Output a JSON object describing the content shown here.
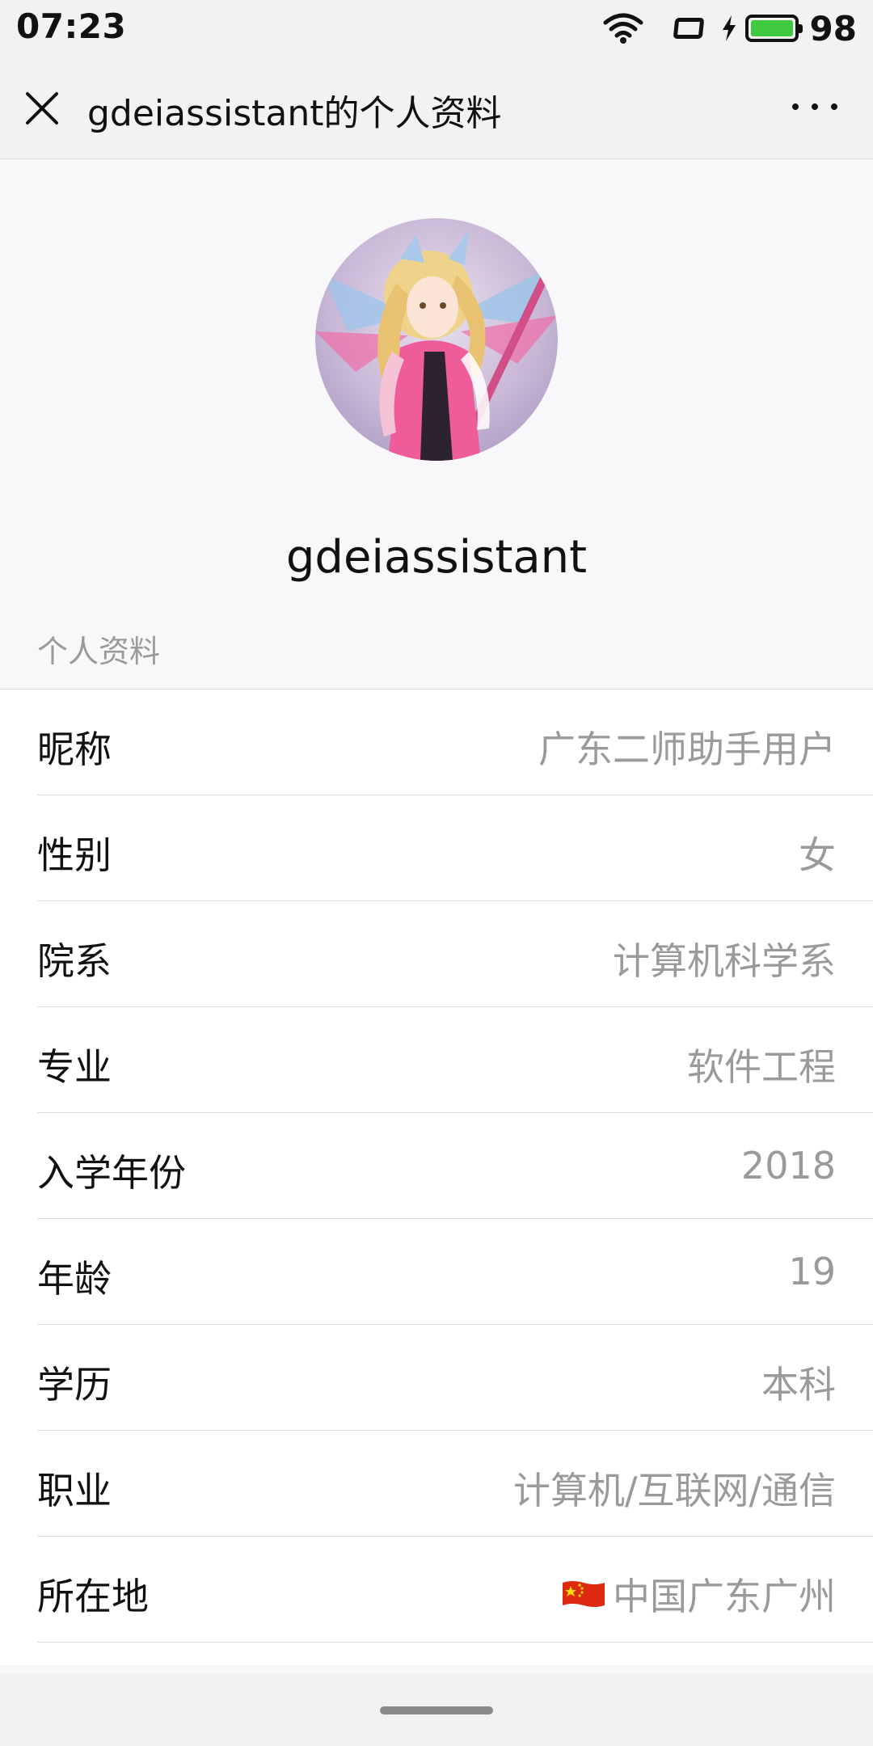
{
  "status_bar": {
    "time": "07:23",
    "battery_level": "98",
    "icons": [
      "wifi-icon",
      "rotate-icon",
      "bolt-icon",
      "battery-icon"
    ]
  },
  "title_bar": {
    "title": "gdeiassistant的个人资料",
    "close_icon": "close-icon",
    "more_icon": "more-icon"
  },
  "profile": {
    "username": "gdeiassistant",
    "section_label": "个人资料"
  },
  "info_rows": [
    {
      "label": "昵称",
      "value": "广东二师助手用户"
    },
    {
      "label": "性别",
      "value": "女"
    },
    {
      "label": "院系",
      "value": "计算机科学系"
    },
    {
      "label": "专业",
      "value": "软件工程"
    },
    {
      "label": "入学年份",
      "value": "2018"
    },
    {
      "label": "年龄",
      "value": "19"
    },
    {
      "label": "学历",
      "value": "本科"
    },
    {
      "label": "职业",
      "value": "计算机/互联网/通信"
    },
    {
      "label": "所在地",
      "value": "中国广东广州",
      "flag": "china-flag-icon"
    }
  ],
  "colors": {
    "battery_fill": "#3ec93e",
    "value_text": "#9a9a9a",
    "divider": "#dcdcdc"
  }
}
